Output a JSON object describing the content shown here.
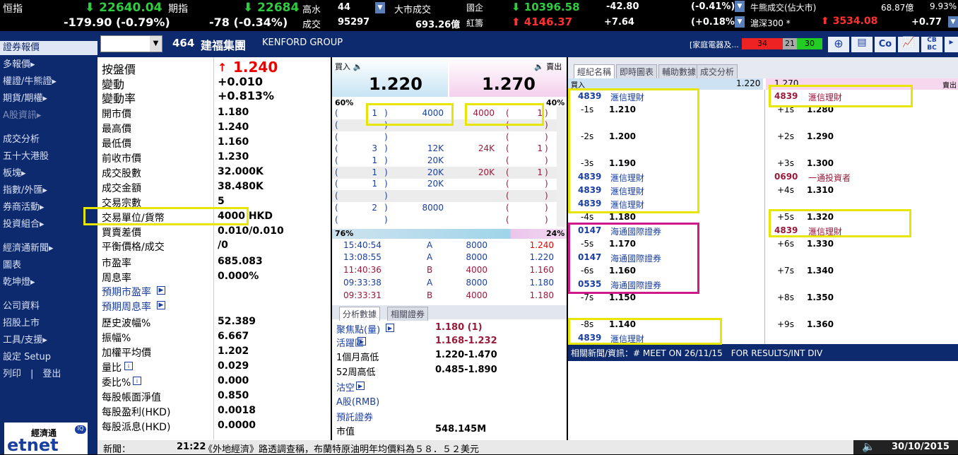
{
  "ticker": {
    "hsi_label": "恒指",
    "hsi_value": "22640.04",
    "hsi_change": "-179.90 (-0.79%)",
    "fut_label": "期指",
    "fut_value": "22684",
    "fut_change": "-78 (-0.34%)",
    "high_label": "高水",
    "high_value": "44",
    "vol_label": "成交",
    "vol_value": "95297",
    "mkt_label": "大市成交",
    "mkt_value": "693.26億",
    "hsce_label": "國企",
    "hsce_value": "10396.58",
    "hsce_change": "-42.80",
    "hsce_pct": "(-0.41%)",
    "red_label": "紅籌",
    "red_value": "4146.37",
    "red_change": "+7.64",
    "red_pct": "(+0.18%)",
    "bull_label": "牛熊成交(佔大市)",
    "bull_value": "68.87億",
    "bull_pct": "9.93%",
    "hs300_label": "滬深300 *",
    "hs300_value": "3534.08",
    "hs300_change": "+0.77"
  },
  "nav": [
    "證券報價",
    "多報價▸",
    "權證/牛熊證▸",
    "期貨/期權▸",
    "A股資訊▸",
    "成交分析",
    "五十大港股",
    "板塊▸",
    "指數/外匯▸",
    "券商活動▸",
    "投資組合▸",
    "經濟通新聞▸",
    "圖表",
    "乾坤燈▸",
    "公司資料",
    "招股上市",
    "工具/支援▸",
    "設定 Setup",
    "列印　|　登出"
  ],
  "header": {
    "code": "464",
    "name_cn": "建福集團",
    "name_en": "KENFORD GROUP",
    "sector": "[家庭電器及...",
    "bar_red": "34",
    "bar_gray": "21",
    "bar_green": "30"
  },
  "quote": {
    "rows": [
      {
        "label": "按盤價",
        "value": "1.240",
        "big": true
      },
      {
        "label": "變動",
        "value": "+0.010"
      },
      {
        "label": "變動率",
        "value": "+0.813%"
      },
      {
        "label": "開市價",
        "value": "1.180"
      },
      {
        "label": "最高價",
        "value": "1.240"
      },
      {
        "label": "最低價",
        "value": "1.160"
      },
      {
        "label": "前收市價",
        "value": "1.230"
      },
      {
        "label": "成交股數",
        "value": "32.000K"
      },
      {
        "label": "成交金額",
        "value": "38.480K"
      },
      {
        "label": "交易宗數",
        "value": "5"
      },
      {
        "label": "交易單位/貨幣",
        "value": "4000 HKD"
      },
      {
        "label": "買賣差價",
        "value": "0.010/0.010"
      },
      {
        "label": "平衡價格/成交",
        "value": "/0"
      },
      {
        "label": "市盈率",
        "value": "685.083"
      },
      {
        "label": "周息率",
        "value": "0.000%"
      },
      {
        "label": "預期市盈率",
        "value": ""
      },
      {
        "label": "預期周息率",
        "value": ""
      },
      {
        "label": "歷史波幅%",
        "value": "52.389"
      },
      {
        "label": "振幅%",
        "value": "6.667"
      },
      {
        "label": "加權平均價",
        "value": "1.202"
      },
      {
        "label": "量比",
        "value": "0.029"
      },
      {
        "label": "委比%",
        "value": "0.000"
      },
      {
        "label": "每股帳面淨值",
        "value": "0.850"
      },
      {
        "label": "每股盈利(HKD)",
        "value": "0.0018"
      },
      {
        "label": "每股派息(HKD)",
        "value": "0.0000"
      }
    ]
  },
  "orderbook": {
    "bid_label": "買入",
    "ask_label": "賣出",
    "bid": "1.220",
    "ask": "1.270",
    "bid_pct": "60%",
    "ask_pct": "40%",
    "bids": [
      [
        "1",
        "4000"
      ],
      [
        "",
        ""
      ],
      [
        "",
        ""
      ],
      [
        "3",
        "12K"
      ],
      [
        "1",
        "20K"
      ],
      [
        "1",
        "20K"
      ],
      [
        "1",
        "20K"
      ],
      [
        "",
        ""
      ],
      [
        "2",
        "8000"
      ],
      [
        "",
        ""
      ]
    ],
    "asks": [
      [
        "4000",
        "1"
      ],
      [
        "",
        ""
      ],
      [
        "",
        ""
      ],
      [
        "24K",
        "1"
      ],
      [
        "",
        ""
      ],
      [
        "20K",
        "1"
      ],
      [
        "",
        ""
      ],
      [
        "",
        ""
      ],
      [
        "",
        ""
      ],
      [
        "",
        ""
      ]
    ],
    "buy_ratio": "76%",
    "sell_ratio": "24%",
    "trades": [
      [
        "15:40:54",
        "A",
        "8000",
        "1.240"
      ],
      [
        "13:08:55",
        "A",
        "8000",
        "1.220"
      ],
      [
        "11:40:36",
        "B",
        "4000",
        "1.160"
      ],
      [
        "09:33:38",
        "A",
        "8000",
        "1.180"
      ],
      [
        "09:33:31",
        "B",
        "4000",
        "1.180"
      ]
    ]
  },
  "analysis": {
    "tab1": "分析數據",
    "tab2": "相關證券",
    "rows": [
      {
        "label": "聚焦點(量)",
        "value": "1.180  (1)",
        "link": true
      },
      {
        "label": "活躍區",
        "value": "1.168-1.232",
        "link": true
      },
      {
        "label": "1個月高低",
        "value": "1.220-1.470"
      },
      {
        "label": "52周高低",
        "value": "0.485-1.890"
      },
      {
        "label": "沽空",
        "value": "",
        "link": true
      },
      {
        "label": "A股(RMB)",
        "value": ""
      },
      {
        "label": "預託證券",
        "value": ""
      },
      {
        "label": "市值",
        "value": "548.145M"
      }
    ]
  },
  "broker": {
    "tabs": [
      "經紀名稱",
      "即時圖表",
      "輔助數據",
      "成交分析"
    ],
    "bid_label": "買入",
    "bid_price": "1.220",
    "ask_price": "1.270",
    "ask_label": "賣出",
    "left": [
      [
        "4839",
        "滙信理財"
      ],
      [
        "-1s",
        "1.210"
      ],
      [
        "",
        ""
      ],
      [
        "-2s",
        "1.200"
      ],
      [
        "",
        ""
      ],
      [
        "-3s",
        "1.190"
      ],
      [
        "4839",
        "滙信理財"
      ],
      [
        "4839",
        "滙信理財"
      ],
      [
        "4839",
        "滙信理財"
      ],
      [
        "-4s",
        "1.180"
      ],
      [
        "0147",
        "海通國際證券"
      ],
      [
        "-5s",
        "1.170"
      ],
      [
        "0147",
        "海通國際證券"
      ],
      [
        "-6s",
        "1.160"
      ],
      [
        "0535",
        "海通國際證券"
      ],
      [
        "-7s",
        "1.150"
      ],
      [
        "",
        ""
      ],
      [
        "-8s",
        "1.140"
      ],
      [
        "4839",
        "滙信理財"
      ]
    ],
    "right": [
      [
        "4839",
        "滙信理財"
      ],
      [
        "+1s",
        "1.280"
      ],
      [
        "",
        ""
      ],
      [
        "+2s",
        "1.290"
      ],
      [
        "",
        ""
      ],
      [
        "+3s",
        "1.300"
      ],
      [
        "0690",
        "一通投資者"
      ],
      [
        "+4s",
        "1.310"
      ],
      [
        "",
        ""
      ],
      [
        "+5s",
        "1.320"
      ],
      [
        "4839",
        "滙信理財"
      ],
      [
        "+6s",
        "1.330"
      ],
      [
        "",
        ""
      ],
      [
        "+7s",
        "1.340"
      ],
      [
        "",
        ""
      ],
      [
        "+8s",
        "1.350"
      ],
      [
        "",
        ""
      ],
      [
        "+9s",
        "1.360"
      ]
    ],
    "news": "相關新聞/資訊：# MEET ON 26/11/15　FOR RESULTS/INT DIV"
  },
  "newsbar": {
    "label": "新聞：",
    "time": "21:22",
    "text": "《外地經濟》路透調查稱，布蘭特原油明年均價料為５８．５２美元",
    "date": "30/10/2015"
  }
}
